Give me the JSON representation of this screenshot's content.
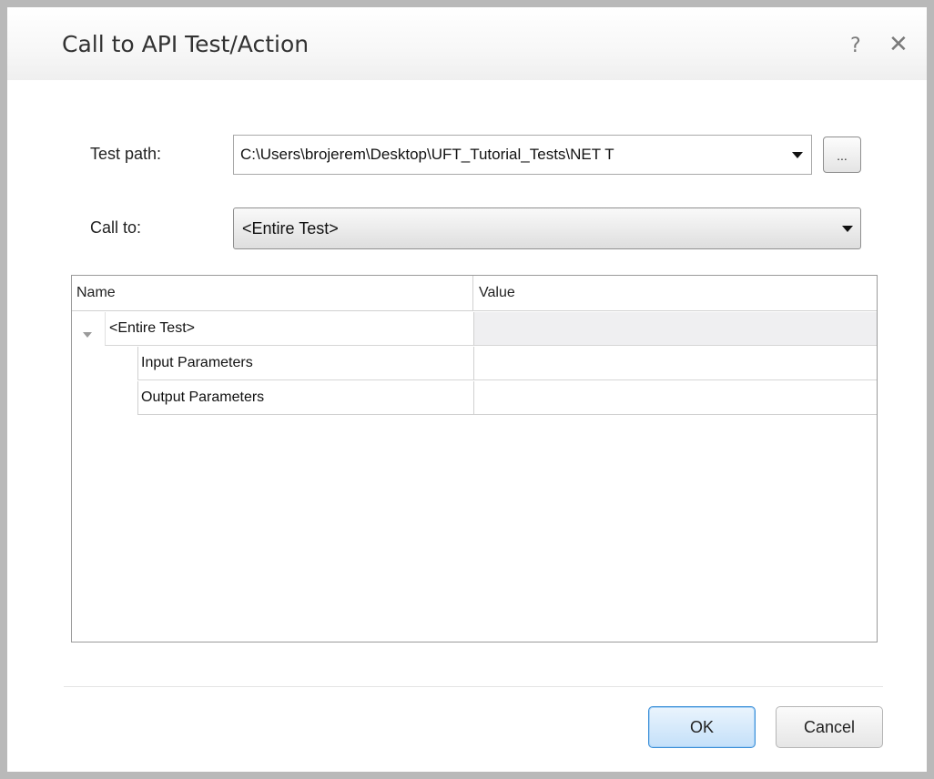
{
  "window": {
    "title": "Call to API Test/Action",
    "help_glyph": "?",
    "close_glyph": "✕"
  },
  "form": {
    "test_path_label": "Test path:",
    "test_path_value": "C:\\Users\\brojerem\\Desktop\\UFT_Tutorial_Tests\\NET T",
    "browse_label": "...",
    "call_to_label": "Call to:",
    "call_to_value": "<Entire Test>"
  },
  "grid": {
    "columns": [
      "Name",
      "Value"
    ],
    "rows": [
      {
        "name": "<Entire Test>",
        "value": "",
        "level": 0,
        "expanded": true
      },
      {
        "name": "Input Parameters",
        "value": "",
        "level": 1
      },
      {
        "name": "Output Parameters",
        "value": "",
        "level": 1
      }
    ]
  },
  "buttons": {
    "ok": "OK",
    "cancel": "Cancel"
  },
  "colors": {
    "ok_border": "#3c8fd8",
    "selected_row_value_bg": "#efeff1"
  }
}
